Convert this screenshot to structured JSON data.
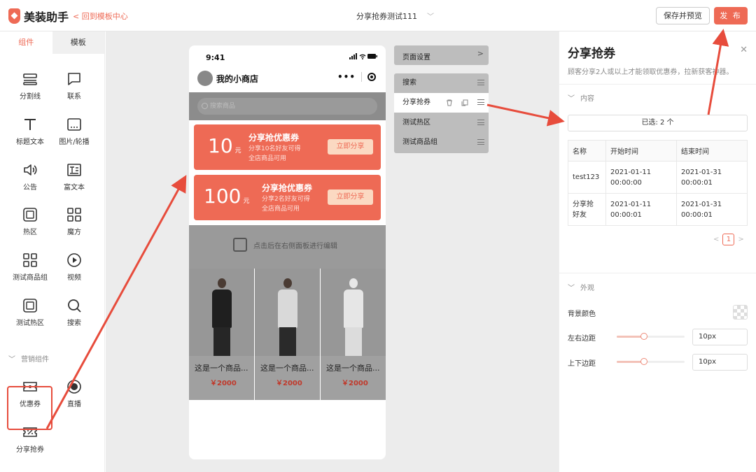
{
  "header": {
    "app_name": "美装助手",
    "back_link": "< 回到模板中心",
    "page_title": "分享抢券测试111",
    "save_preview": "保存并预览",
    "publish": "发 布"
  },
  "left_panel": {
    "tabs": [
      {
        "label": "组件"
      },
      {
        "label": "模板"
      }
    ],
    "components": [
      {
        "label": "分割线",
        "icon": "divider-icon"
      },
      {
        "label": "联系",
        "icon": "chat-icon"
      },
      {
        "label": "标题文本",
        "icon": "text-icon"
      },
      {
        "label": "图片/轮播",
        "icon": "image-icon"
      },
      {
        "label": "公告",
        "icon": "speaker-icon"
      },
      {
        "label": "富文本",
        "icon": "richtext-icon"
      },
      {
        "label": "热区",
        "icon": "hotzone-icon"
      },
      {
        "label": "魔方",
        "icon": "grid-icon"
      },
      {
        "label": "测试商品组",
        "icon": "grid-icon"
      },
      {
        "label": "视频",
        "icon": "play-icon"
      },
      {
        "label": "测试热区",
        "icon": "hotzone-icon"
      },
      {
        "label": "搜索",
        "icon": "search-icon"
      }
    ],
    "marketing_section": "营销组件",
    "marketing_components": [
      {
        "label": "优惠券",
        "icon": "ticket-icon"
      },
      {
        "label": "直播",
        "icon": "live-icon"
      },
      {
        "label": "分享抢券",
        "icon": "share-coupon-icon"
      }
    ]
  },
  "phone": {
    "time": "9:41",
    "shop_name": "我的小商店",
    "search_placeholder": "搜索商品",
    "coupons": [
      {
        "amount": "10",
        "unit": "元",
        "title": "分享抢优惠券",
        "line1": "分享10名好友可得",
        "line2": "全店商品可用",
        "button": "立即分享"
      },
      {
        "amount": "100",
        "unit": "元",
        "title": "分享抢优惠券",
        "line1": "分享2名好友可得",
        "line2": "全店商品可用",
        "button": "立即分享"
      }
    ],
    "hotzone_hint": "点击后在右侧面板进行编辑",
    "products": [
      {
        "name": "这是一个商品...",
        "price": "￥2000"
      },
      {
        "name": "这是一个商品...",
        "price": "￥2000"
      },
      {
        "name": "这是一个商品...",
        "price": "￥2000"
      }
    ]
  },
  "modules": {
    "page_settings": "页面设置",
    "items": [
      {
        "label": "搜索"
      },
      {
        "label": "分享抢券"
      },
      {
        "label": "测试热区"
      },
      {
        "label": "测试商品组"
      }
    ]
  },
  "right_panel": {
    "title": "分享抢券",
    "description": "顾客分享2人或以上才能领取优惠券，拉新获客神器。",
    "content_section": "内容",
    "selected": "已选: 2 个",
    "table": {
      "headers": [
        "名称",
        "开始时间",
        "结束时间"
      ],
      "rows": [
        {
          "name": "test123",
          "start_date": "2021-01-11",
          "start_time": "00:00:00",
          "end_date": "2021-01-31",
          "end_time": "00:00:01"
        },
        {
          "name_l1": "分享抢",
          "name_l2": "好友",
          "start_date": "2021-01-11",
          "start_time": "00:00:01",
          "end_date": "2021-01-31",
          "end_time": "00:00:01"
        }
      ]
    },
    "page": "1",
    "appearance_section": "外观",
    "bg_color_label": "背景颜色",
    "lr_margin_label": "左右边距",
    "lr_margin_value": "10px",
    "tb_margin_label": "上下边距",
    "tb_margin_value": "10px",
    "lr_margin_fraction": 0.4,
    "tb_margin_fraction": 0.4
  },
  "colors": {
    "accent": "#ee6a55",
    "annotation_arrow": "#e74c3c"
  }
}
